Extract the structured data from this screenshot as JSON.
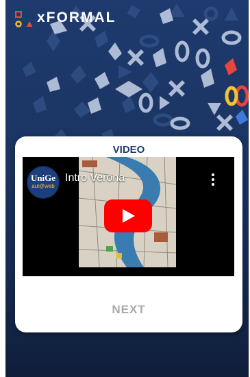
{
  "app": {
    "logo_text": "xFORMAL",
    "colors": {
      "background_top": "#1e3a6e",
      "background_bottom": "#0f1d3a",
      "accent_red": "#e8453c",
      "accent_yellow": "#f2c230",
      "accent_blue": "#3d7bd6",
      "title_navy": "#1f3b6b",
      "play_red": "#ff0000"
    }
  },
  "card": {
    "title": "VIDEO",
    "next_label": "NEXT"
  },
  "video": {
    "title": "Intro Verona",
    "channel": {
      "line1": "UniGe",
      "line2": "aul@web"
    },
    "icons": {
      "play": "play-icon",
      "menu": "more-vertical-icon"
    }
  }
}
